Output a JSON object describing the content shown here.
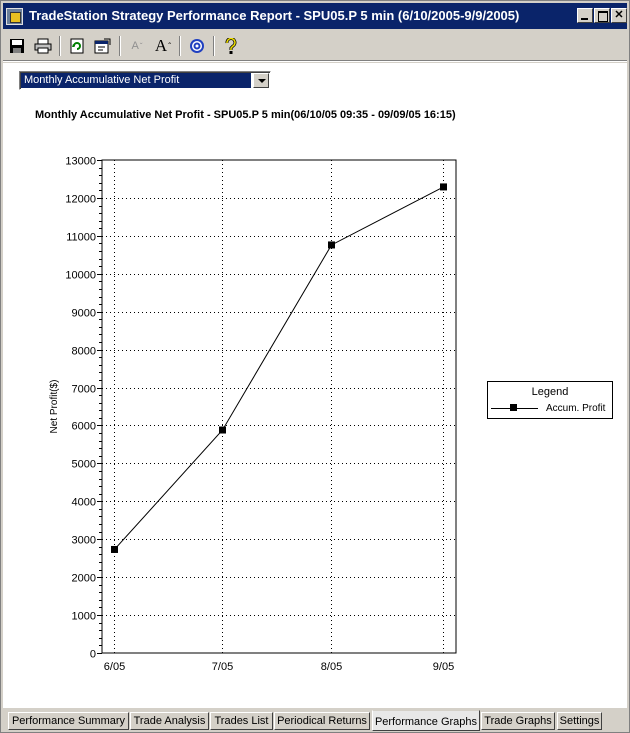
{
  "window": {
    "title": "TradeStation Strategy Performance Report - SPU05.P 5 min (6/10/2005-9/9/2005)",
    "controls": [
      "minimize",
      "maximize",
      "close"
    ]
  },
  "toolbar": {
    "icons": [
      "save-icon",
      "print-icon",
      "refresh-icon",
      "properties-icon",
      "decrease-font-icon",
      "increase-font-icon",
      "target-icon",
      "help-icon"
    ]
  },
  "report_selector": {
    "value": "Monthly Accumulative Net Profit"
  },
  "chart_title": "Monthly Accumulative Net Profit - SPU05.P 5 min(06/10/05 09:35 - 09/09/05 16:15)",
  "legend": {
    "title": "Legend",
    "label": "Accum. Profit"
  },
  "chart_data": {
    "type": "line",
    "title": "Monthly Accumulative Net Profit - SPU05.P 5 min(06/10/05 09:35 - 09/09/05 16:15)",
    "xlabel": "",
    "ylabel": "Net Profit($)",
    "categories": [
      "6/05",
      "7/05",
      "8/05",
      "9/05"
    ],
    "series": [
      {
        "name": "Accum. Profit",
        "values": [
          2730,
          5880,
          10760,
          12290
        ]
      }
    ],
    "ylim": [
      0,
      13000
    ],
    "yticks": [
      0,
      1000,
      2000,
      3000,
      4000,
      5000,
      6000,
      7000,
      8000,
      9000,
      10000,
      11000,
      12000,
      13000
    ],
    "grid": true,
    "legend_position": "right"
  },
  "tabs": [
    {
      "label": "Performance Summary",
      "active": false
    },
    {
      "label": "Trade Analysis",
      "active": false
    },
    {
      "label": "Trades List",
      "active": false
    },
    {
      "label": "Periodical Returns",
      "active": false
    },
    {
      "label": "Performance Graphs",
      "active": true
    },
    {
      "label": "Trade Graphs",
      "active": false
    },
    {
      "label": "Settings",
      "active": false
    }
  ]
}
